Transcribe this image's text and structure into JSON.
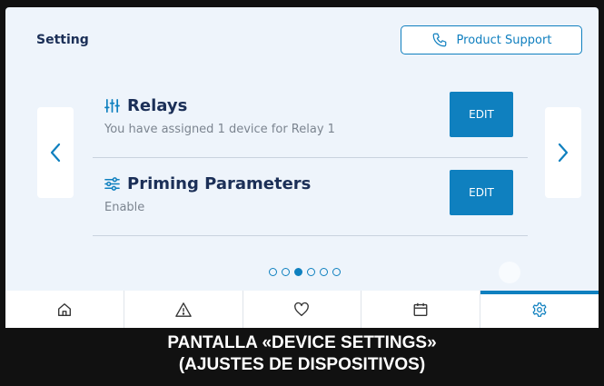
{
  "header": {
    "title": "Setting"
  },
  "support_button": {
    "label": "Product Support",
    "icon": "phone-icon"
  },
  "rows": [
    {
      "title": "Relays",
      "subtitle": "You have assigned 1 device for Relay 1",
      "edit_label": "EDIT",
      "icon": "relay-sliders-icon"
    },
    {
      "title": "Priming Parameters",
      "subtitle": "Enable",
      "edit_label": "EDIT",
      "icon": "priming-sliders-icon"
    }
  ],
  "pagination": {
    "total": 6,
    "current": 3
  },
  "tabs": [
    {
      "name": "home",
      "icon": "home-icon",
      "active": false
    },
    {
      "name": "alerts",
      "icon": "warning-icon",
      "active": false
    },
    {
      "name": "favorites",
      "icon": "heart-icon",
      "active": false
    },
    {
      "name": "schedule",
      "icon": "calendar-icon",
      "active": false
    },
    {
      "name": "settings",
      "icon": "gear-icon",
      "active": true
    }
  ],
  "caption": {
    "line1": "PANTALLA «DEVICE SETTINGS»",
    "line2": "(AJUSTES DE DISPOSITIVOS)"
  },
  "colors": {
    "accent": "#0f80bf",
    "title": "#1b2f57",
    "background": "#eef4fb"
  }
}
